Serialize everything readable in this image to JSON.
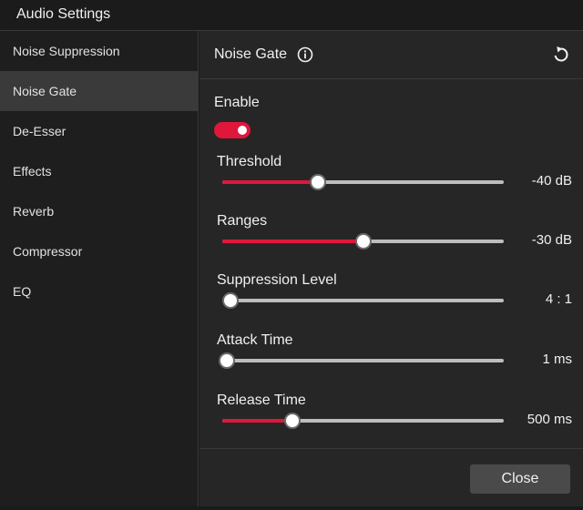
{
  "window": {
    "title": "Audio Settings"
  },
  "sidebar": {
    "items": [
      {
        "label": "Noise Suppression",
        "active": false
      },
      {
        "label": "Noise Gate",
        "active": true
      },
      {
        "label": "De-Esser",
        "active": false
      },
      {
        "label": "Effects",
        "active": false
      },
      {
        "label": "Reverb",
        "active": false
      },
      {
        "label": "Compressor",
        "active": false
      },
      {
        "label": "EQ",
        "active": false
      }
    ]
  },
  "panel": {
    "title": "Noise Gate",
    "info_icon": "info-icon",
    "reset_icon": "reset-icon",
    "enable": {
      "label": "Enable",
      "on": true
    },
    "sliders": [
      {
        "label": "Threshold",
        "value": "-40  dB",
        "fraction": 0.34
      },
      {
        "label": "Ranges",
        "value": "-30  dB",
        "fraction": 0.5
      },
      {
        "label": "Suppression Level",
        "value": "4 : 1",
        "fraction": 0.03
      },
      {
        "label": "Attack Time",
        "value": "1  ms",
        "fraction": 0.015
      },
      {
        "label": "Release Time",
        "value": "500  ms",
        "fraction": 0.25
      }
    ]
  },
  "footer": {
    "close_label": "Close"
  },
  "colors": {
    "accent": "#e0163b",
    "track": "#bdbdbd",
    "active_item": "#3a3a3a",
    "button": "#4a4a4a"
  }
}
